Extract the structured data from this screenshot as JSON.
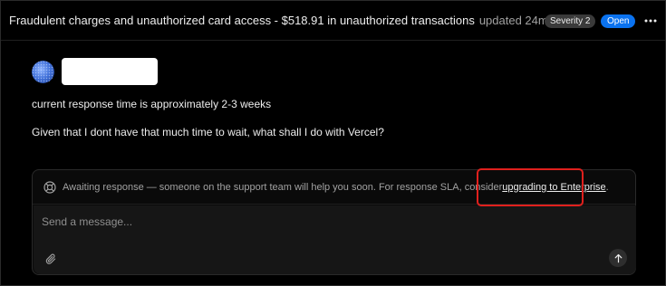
{
  "header": {
    "title": "Fraudulent charges and unauthorized card access - $518.91 in unauthorized transactions",
    "updated": "updated 24m ago",
    "severity_label": "Severity 2",
    "status_label": "Open",
    "more_icon": "more-horizontal-icon"
  },
  "message": {
    "avatar_icon": "avatar",
    "lines": [
      "current response time is approximately 2-3 weeks",
      "Given that I dont have that much time to wait, what shall I do with Vercel?"
    ]
  },
  "notice": {
    "icon": "lifebuoy-icon",
    "text": "Awaiting response — someone on the support team will help you soon. For response SLA, consider ",
    "link_label": "upgrading to Enterprise",
    "period": "."
  },
  "composer": {
    "placeholder": "Send a message...",
    "value": "",
    "attach_icon": "paperclip-icon",
    "send_icon": "arrow-up-icon"
  },
  "colors": {
    "background": "#000000",
    "status_open": "#0a72ef",
    "severity_badge": "#3a3a3a",
    "highlight": "#e0201d"
  }
}
